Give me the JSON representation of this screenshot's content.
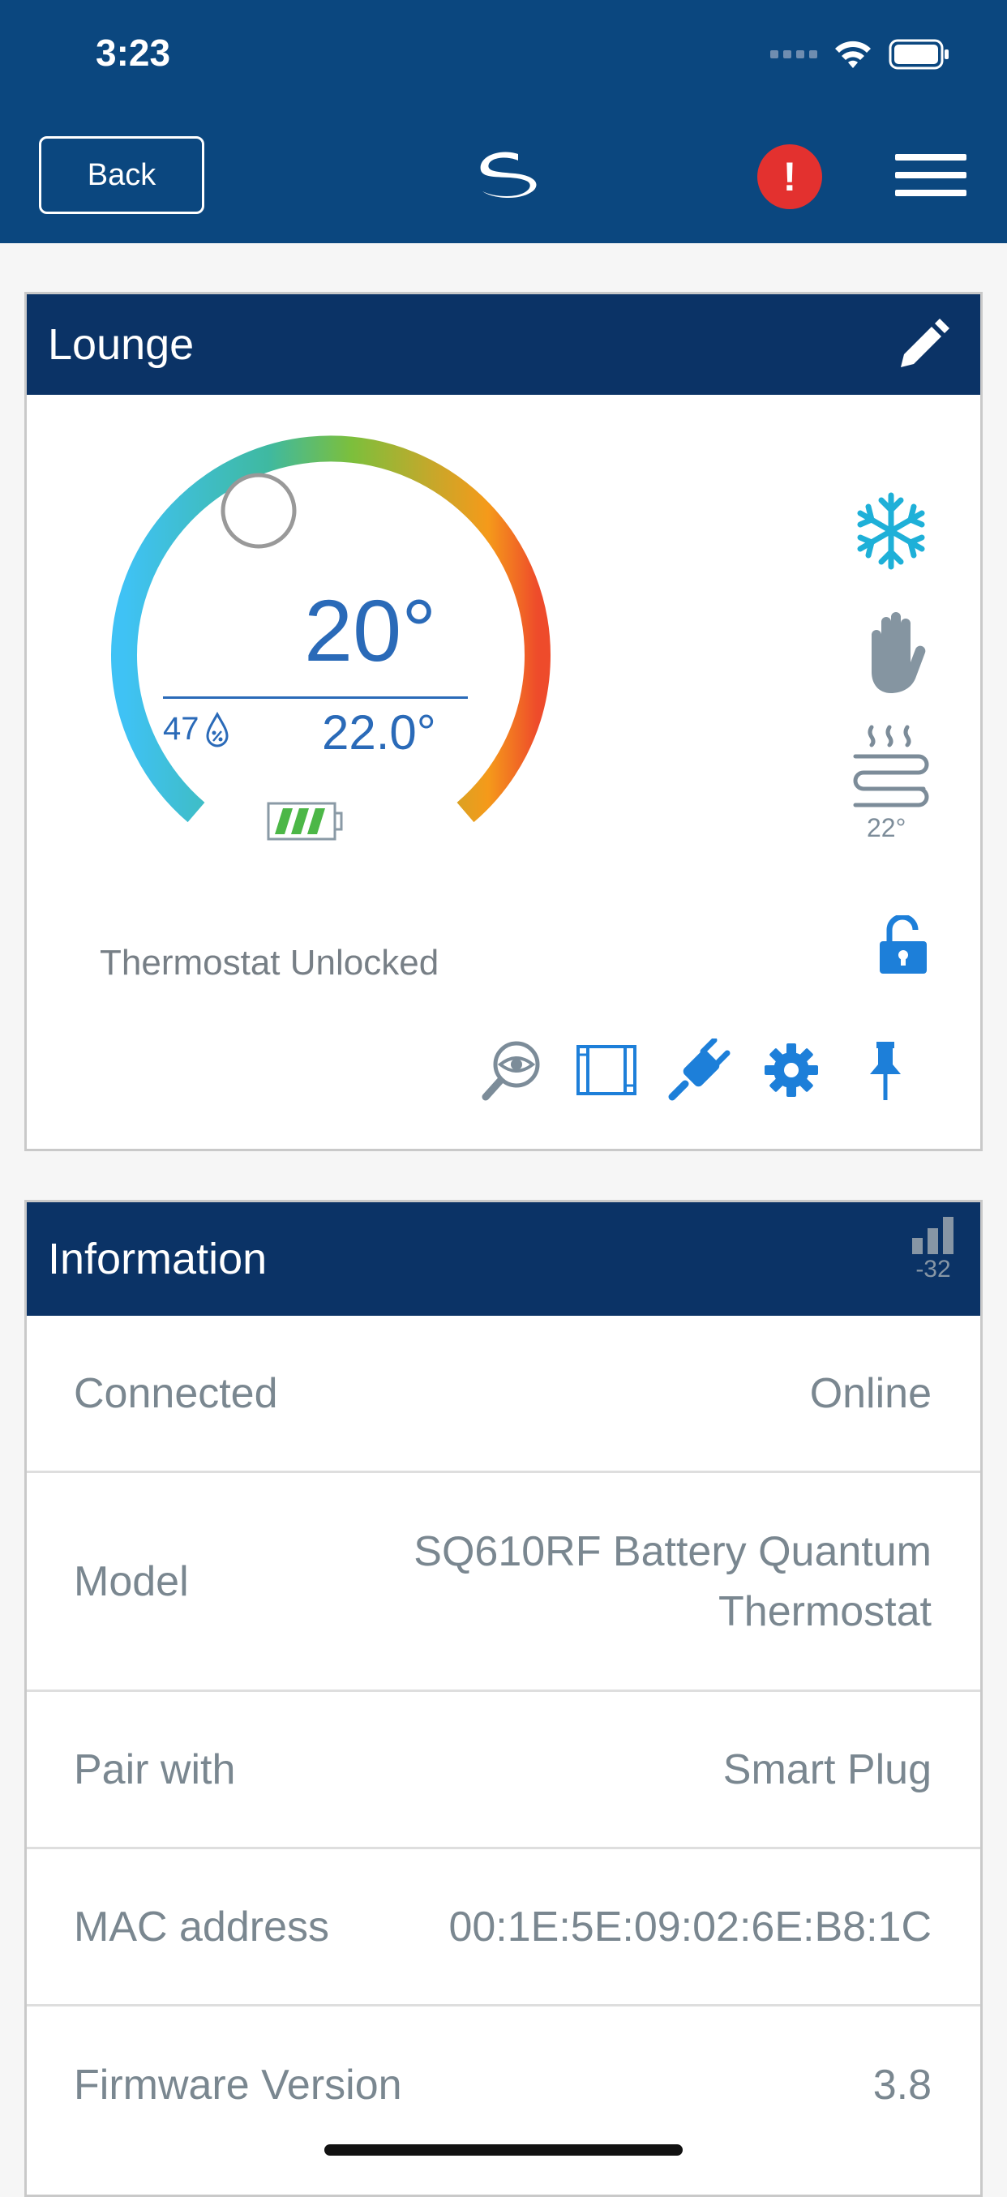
{
  "status_bar": {
    "time": "3:23"
  },
  "header": {
    "back_label": "Back",
    "alert_label": "!",
    "colors": {
      "bar": "#0b477f",
      "alert": "#e3312f"
    }
  },
  "lounge": {
    "title": "Lounge",
    "set_temp": "20°",
    "humidity": "47",
    "current_temp": "22.0°",
    "floor_temp": "22°",
    "lock_status": "Thermostat Unlocked",
    "battery_level": 1.0,
    "icons": [
      "pencil-icon",
      "snowflake-icon",
      "hand-icon",
      "floor-heating-icon",
      "unlock-icon",
      "eye-search-icon",
      "window-icon",
      "plug-icon",
      "gear-icon",
      "pin-icon"
    ]
  },
  "information": {
    "title": "Information",
    "signal_value": "-32",
    "rows": [
      {
        "label": "Connected",
        "value": "Online"
      },
      {
        "label": "Model",
        "value_line1": "SQ610RF Battery Quantum",
        "value_line2": "Thermostat"
      },
      {
        "label": "Pair with",
        "value": "Smart Plug"
      },
      {
        "label": "MAC address",
        "value": "00:1E:5E:09:02:6E:B8:1C"
      },
      {
        "label": "Firmware Version",
        "value": "3.8"
      }
    ]
  }
}
